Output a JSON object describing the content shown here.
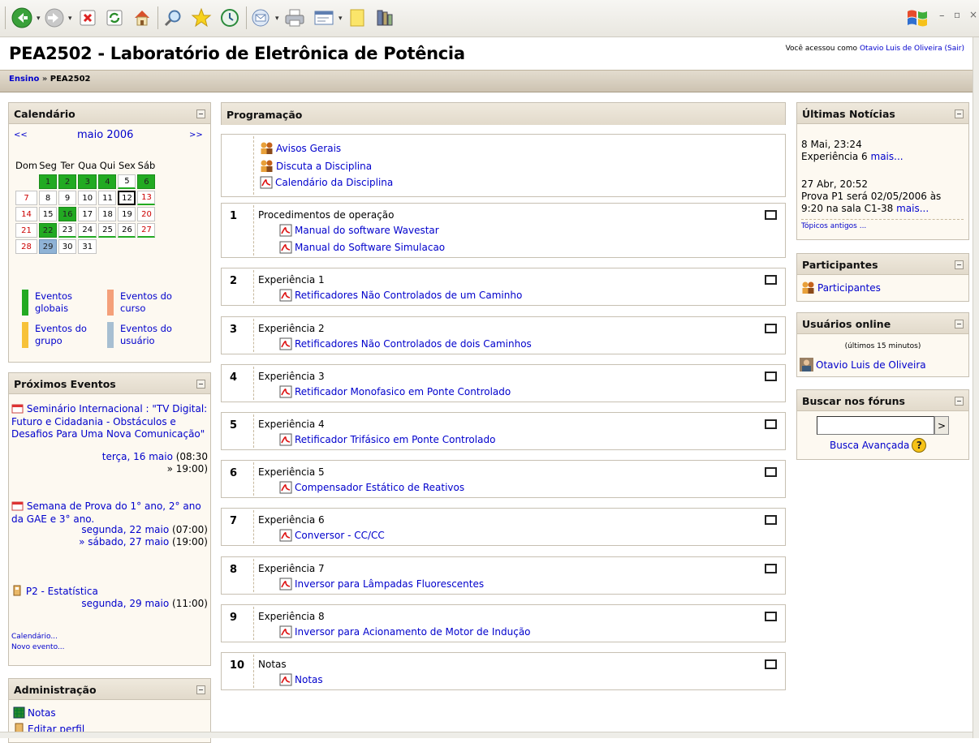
{
  "header": {
    "title": "PEA2502 - Laboratório de Eletrônica de Potência",
    "login_prefix": "Você acessou como",
    "user_name": "Otavio Luis de Oliveira",
    "logout": "(Sair)"
  },
  "breadcrumb": {
    "home": "Ensino",
    "separator": "»",
    "current": "PEA2502"
  },
  "toolbar": {
    "icons": [
      "back-icon",
      "forward-icon",
      "stop-icon",
      "refresh-icon",
      "home-icon",
      "search-icon",
      "favorites-icon",
      "history-icon",
      "mail-icon",
      "print-icon",
      "edit-icon",
      "note-icon",
      "research-icon"
    ],
    "window_controls": [
      "minimize",
      "restore",
      "close"
    ]
  },
  "calendar": {
    "title": "Calendário",
    "prev": "<<",
    "next": ">>",
    "month": "maio 2006",
    "weekdays": [
      "Dom",
      "Seg",
      "Ter",
      "Qua",
      "Qui",
      "Sex",
      "Sáb"
    ],
    "weeks": [
      [
        "",
        "1",
        "2",
        "3",
        "4",
        "5",
        "6"
      ],
      [
        "7",
        "8",
        "9",
        "10",
        "11",
        "12",
        "13"
      ],
      [
        "14",
        "15",
        "16",
        "17",
        "18",
        "19",
        "20"
      ],
      [
        "21",
        "22",
        "23",
        "24",
        "25",
        "26",
        "27"
      ],
      [
        "28",
        "29",
        "30",
        "31",
        "",
        "",
        ""
      ]
    ],
    "today": "12",
    "global_event_days": [
      "1",
      "2",
      "3",
      "4",
      "6",
      "16",
      "22"
    ],
    "user_event_days": [
      "29"
    ],
    "legend": [
      {
        "label": "Eventos globais",
        "color": "#22aa22"
      },
      {
        "label": "Eventos do curso",
        "color": "#f4a07a"
      },
      {
        "label": "Eventos do grupo",
        "color": "#f7c23a"
      },
      {
        "label": "Eventos do usuário",
        "color": "#a7bfd2"
      }
    ]
  },
  "upcoming": {
    "title": "Próximos Eventos",
    "events": [
      {
        "name": "Seminário Internacional : \"TV Digital: Futuro e Cidadania - Obstáculos e Desafios Para Uma Nova Comunicação\"",
        "date": "terça, 16 maio",
        "time": "(08:30",
        "end": "» 19:00)"
      },
      {
        "name": "Semana de Prova do 1° ano, 2° ano da GAE e 3° ano.",
        "date": "segunda, 22 maio",
        "time": "(07:00)",
        "end_date": "» sábado, 27 maio",
        "end_time": "(19:00)"
      },
      {
        "name": "P2 - Estatística",
        "date": "segunda, 29 maio",
        "time": "(11:00)"
      }
    ],
    "calendar_link": "Calendário...",
    "new_event_link": "Novo evento..."
  },
  "admin": {
    "title": "Administração",
    "items": [
      "Notas",
      "Editar perfil"
    ]
  },
  "program": {
    "title": "Programação",
    "top_items": [
      "Avisos Gerais",
      "Discuta a Disciplina",
      "Calendário da Disciplina"
    ],
    "sections": [
      {
        "num": "1",
        "title": "Procedimentos de operação",
        "items": [
          "Manual do software Wavestar",
          "Manual do Software Simulacao"
        ]
      },
      {
        "num": "2",
        "title": "Experiência 1",
        "items": [
          "Retificadores Não Controlados de um Caminho"
        ]
      },
      {
        "num": "3",
        "title": "Experiência 2",
        "items": [
          "Retificadores Não Controlados de dois Caminhos"
        ]
      },
      {
        "num": "4",
        "title": "Experiência 3",
        "items": [
          "Retificador Monofasico em Ponte Controlado"
        ]
      },
      {
        "num": "5",
        "title": "Experiência 4",
        "items": [
          "Retificador Trifásico em Ponte Controlado"
        ]
      },
      {
        "num": "6",
        "title": "Experiência 5",
        "items": [
          "Compensador Estático de Reativos"
        ]
      },
      {
        "num": "7",
        "title": "Experiência 6",
        "items": [
          "Conversor - CC/CC"
        ]
      },
      {
        "num": "8",
        "title": "Experiência 7",
        "items": [
          "Inversor para Lâmpadas Fluorescentes"
        ]
      },
      {
        "num": "9",
        "title": "Experiência 8",
        "items": [
          "Inversor para Acionamento de Motor de Indução"
        ]
      },
      {
        "num": "10",
        "title": "Notas",
        "items": [
          "Notas"
        ]
      }
    ]
  },
  "news": {
    "title": "Últimas Notícias",
    "items": [
      {
        "date": "8 Mai, 23:24",
        "text": "Experiência 6",
        "more": "mais..."
      },
      {
        "date": "27 Abr, 20:52",
        "text": "Prova P1 será 02/05/2006 às 9:20 na sala C1-38",
        "more": "mais..."
      }
    ],
    "older": "Tópicos antigos ..."
  },
  "participants": {
    "title": "Participantes",
    "link": "Participantes"
  },
  "online": {
    "title": "Usuários online",
    "subtitle": "(últimos 15 minutos)",
    "user": "Otavio Luis de Oliveira"
  },
  "forum_search": {
    "title": "Buscar nos fóruns",
    "button": ">",
    "advanced": "Busca Avançada",
    "help": "?"
  }
}
